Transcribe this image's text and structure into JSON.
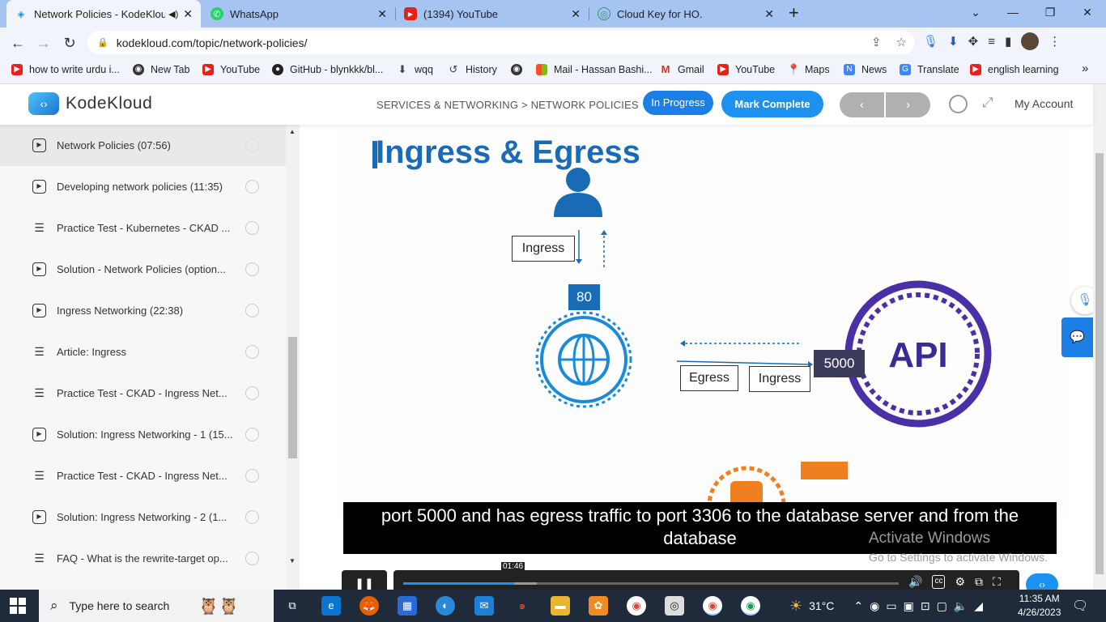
{
  "browser": {
    "tabs": [
      {
        "title": "Network Policies - KodeKlou",
        "favicon": "kodekloud-icon",
        "active": true
      },
      {
        "title": "WhatsApp",
        "favicon": "whatsapp-icon",
        "active": false
      },
      {
        "title": "(1394) YouTube",
        "favicon": "youtube-icon",
        "active": false
      },
      {
        "title": "Cloud Key for HO.",
        "favicon": "cloud-key-icon",
        "active": false
      }
    ],
    "new_tab": "+",
    "url": "kodekloud.com/topic/network-policies/",
    "bookmarks": [
      {
        "label": "how to write urdu i...",
        "icon": "youtube-icon",
        "color": "#e62117"
      },
      {
        "label": "New Tab",
        "icon": "globe-icon",
        "color": "#333333"
      },
      {
        "label": "YouTube",
        "icon": "youtube-icon",
        "color": "#e62117"
      },
      {
        "label": "GitHub - blynkkk/bl...",
        "icon": "github-icon",
        "color": "#222222"
      },
      {
        "label": "wqq",
        "icon": "download-icon",
        "color": "#444444"
      },
      {
        "label": "History",
        "icon": "history-icon",
        "color": "#444444"
      },
      {
        "label": "",
        "icon": "globe-icon",
        "color": "#333333"
      },
      {
        "label": "Mail - Hassan Bashi...",
        "icon": "microsoft-icon",
        "color": "#f35325"
      },
      {
        "label": "Gmail",
        "icon": "gmail-icon",
        "color": "#d93025"
      },
      {
        "label": "YouTube",
        "icon": "youtube-icon",
        "color": "#e62117"
      },
      {
        "label": "Maps",
        "icon": "maps-icon",
        "color": "#34a853"
      },
      {
        "label": "News",
        "icon": "news-icon",
        "color": "#4285f4"
      },
      {
        "label": "Translate",
        "icon": "translate-icon",
        "color": "#4285f4"
      },
      {
        "label": "english learning",
        "icon": "youtube-icon",
        "color": "#e62117"
      }
    ],
    "more_bookmarks": "»"
  },
  "site": {
    "logo_text": "KodeKloud",
    "breadcrumb": "SERVICES & NETWORKING > NETWORK POLICIES",
    "status_button": "In Progress",
    "complete_button": "Mark Complete",
    "prev": "‹",
    "next": "›",
    "account": "My Account",
    "accent": "#1c91f0"
  },
  "lessons": [
    {
      "title": "Network Policies (07:56)",
      "type": "video",
      "current": true
    },
    {
      "title": "Developing network policies (11:35)",
      "type": "video",
      "current": false
    },
    {
      "title": "Practice Test - Kubernetes - CKAD ...",
      "type": "lab",
      "current": false
    },
    {
      "title": "Solution - Network Policies (option...",
      "type": "video",
      "current": false
    },
    {
      "title": "Ingress Networking (22:38)",
      "type": "video",
      "current": false
    },
    {
      "title": "Article: Ingress",
      "type": "lab",
      "current": false
    },
    {
      "title": "Practice Test - CKAD - Ingress Net...",
      "type": "lab",
      "current": false
    },
    {
      "title": "Solution: Ingress Networking - 1 (15...",
      "type": "video",
      "current": false
    },
    {
      "title": "Practice Test - CKAD - Ingress Net...",
      "type": "lab",
      "current": false
    },
    {
      "title": "Solution: Ingress Networking - 2 (1...",
      "type": "video",
      "current": false
    },
    {
      "title": "FAQ - What is the rewrite-target op...",
      "type": "lab",
      "current": false
    }
  ],
  "slide": {
    "title": "Ingress & Egress",
    "ingress_label": "Ingress",
    "port_web": "80",
    "egress_label": "Egress",
    "ingress_label2": "Ingress",
    "port_api": "5000",
    "api_label": "API"
  },
  "player": {
    "caption": "port 5000 and has egress traffic to port 3306 to the database server and from the database",
    "timestamp": "01:46",
    "progress": 0.224,
    "buffered": 0.27
  },
  "watermark": {
    "line1": "Activate Windows",
    "line2": "Go to Settings to activate Windows."
  },
  "taskbar": {
    "search_placeholder": "Type here to search",
    "temperature": "31°C",
    "time": "11:35 AM",
    "date": "4/26/2023"
  }
}
